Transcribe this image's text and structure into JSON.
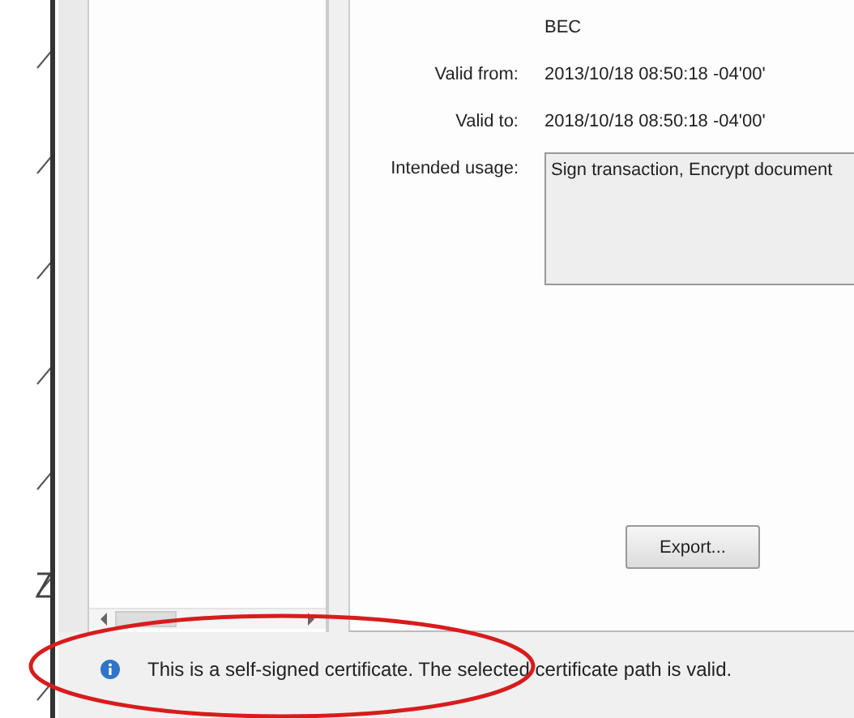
{
  "details": {
    "issuer_value": "BEC",
    "fields": [
      {
        "label": "Valid from:",
        "value": "2013/10/18 08:50:18 -04'00'"
      },
      {
        "label": "Valid to:",
        "value": "2018/10/18 08:50:18 -04'00'"
      }
    ],
    "intended_usage": {
      "label": "Intended usage:",
      "value": "Sign transaction, Encrypt document"
    }
  },
  "export_button": "Export...",
  "status": {
    "message": "This is a self-signed certificate. The selected certificate path is valid."
  }
}
